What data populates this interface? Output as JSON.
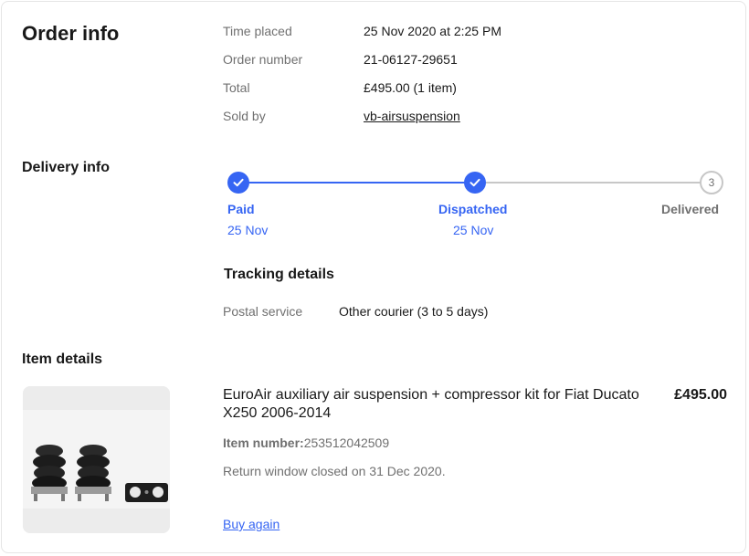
{
  "order_info": {
    "title": "Order info",
    "rows": [
      {
        "label": "Time placed",
        "value": "25 Nov 2020 at 2:25 PM"
      },
      {
        "label": "Order number",
        "value": "21-06127-29651"
      },
      {
        "label": "Total",
        "value": "£495.00 (1 item)"
      },
      {
        "label": "Sold by",
        "value": "vb-airsuspension"
      }
    ]
  },
  "delivery_info": {
    "title": "Delivery info",
    "steps": [
      {
        "label": "Paid",
        "date": "25 Nov",
        "state": "done",
        "icon": "check-icon"
      },
      {
        "label": "Dispatched",
        "date": "25 Nov",
        "state": "done",
        "icon": "check-icon"
      },
      {
        "label": "Delivered",
        "date": "",
        "state": "pending",
        "number": "3"
      }
    ],
    "tracking": {
      "title": "Tracking details",
      "label": "Postal service",
      "value": "Other courier (3 to 5 days)"
    }
  },
  "item_details": {
    "title": "Item details",
    "item_title": "EuroAir auxiliary air suspension + compressor kit for Fiat Ducato X250 2006-2014",
    "price": "£495.00",
    "item_number_label": "Item number:",
    "item_number": "253512042509",
    "return_text": "Return window closed on 31 Dec 2020.",
    "buy_again": "Buy again"
  },
  "colors": {
    "accent": "#3665f3",
    "muted_text": "#707070",
    "pending": "#c7c7c7"
  }
}
